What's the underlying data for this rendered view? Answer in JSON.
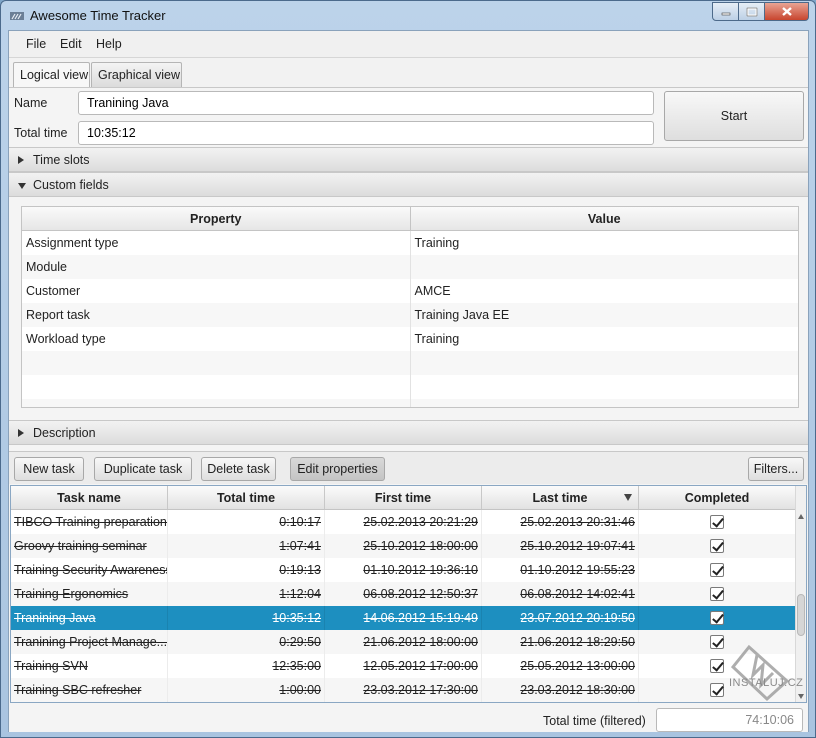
{
  "window": {
    "title": "Awesome Time Tracker"
  },
  "menu": {
    "items": [
      "File",
      "Edit",
      "Help"
    ]
  },
  "tabs": [
    {
      "label": "Logical view",
      "active": true
    },
    {
      "label": "Graphical view",
      "active": false
    }
  ],
  "form": {
    "name_label": "Name",
    "name_value": "Tranining Java",
    "total_label": "Total time",
    "total_value": "10:35:12",
    "start_label": "Start"
  },
  "sections": {
    "time_slots": "Time slots",
    "custom_fields": "Custom fields",
    "description": "Description"
  },
  "properties": {
    "headers": [
      "Property",
      "Value"
    ],
    "rows": [
      [
        "Assignment type",
        "Training"
      ],
      [
        "Module",
        ""
      ],
      [
        "Customer",
        "AMCE"
      ],
      [
        "Report task",
        "Training Java EE"
      ],
      [
        "Workload type",
        "Training"
      ]
    ]
  },
  "toolbar": {
    "new_task": "New task",
    "duplicate_task": "Duplicate task",
    "delete_task": "Delete task",
    "edit_properties": "Edit properties",
    "filters": "Filters..."
  },
  "tasks": {
    "headers": [
      "Task name",
      "Total time",
      "First time",
      "Last time",
      "Completed"
    ],
    "rows": [
      {
        "name": "TIBCO Training preparations",
        "total": "0:10:17",
        "first": "25.02.2013 20:21:29",
        "last": "25.02.2013 20:31:46",
        "completed": true
      },
      {
        "name": "Groovy training seminar",
        "total": "1:07:41",
        "first": "25.10.2012 18:00:00",
        "last": "25.10.2012 19:07:41",
        "completed": true
      },
      {
        "name": "Training Security Awareness",
        "total": "0:19:13",
        "first": "01.10.2012 19:36:10",
        "last": "01.10.2012 19:55:23",
        "completed": true
      },
      {
        "name": "Training Ergonomics",
        "total": "1:12:04",
        "first": "06.08.2012 12:50:37",
        "last": "06.08.2012 14:02:41",
        "completed": true
      },
      {
        "name": "Tranining Java",
        "total": "10:35:12",
        "first": "14.06.2012 15:19:49",
        "last": "23.07.2012 20:19:50",
        "completed": true
      },
      {
        "name": "Tranining Project Manage...",
        "total": "0:29:50",
        "first": "21.06.2012 18:00:00",
        "last": "21.06.2012 18:29:50",
        "completed": true
      },
      {
        "name": "Training SVN",
        "total": "12:35:00",
        "first": "12.05.2012 17:00:00",
        "last": "25.05.2012 13:00:00",
        "completed": true
      },
      {
        "name": "Training SBC refresher",
        "total": "1:00:00",
        "first": "23.03.2012 17:30:00",
        "last": "23.03.2012 18:30:00",
        "completed": true
      }
    ]
  },
  "status": {
    "label": "Total time (filtered)",
    "value": "74:10:06"
  },
  "watermark": "INSTALUJ.CZ"
}
